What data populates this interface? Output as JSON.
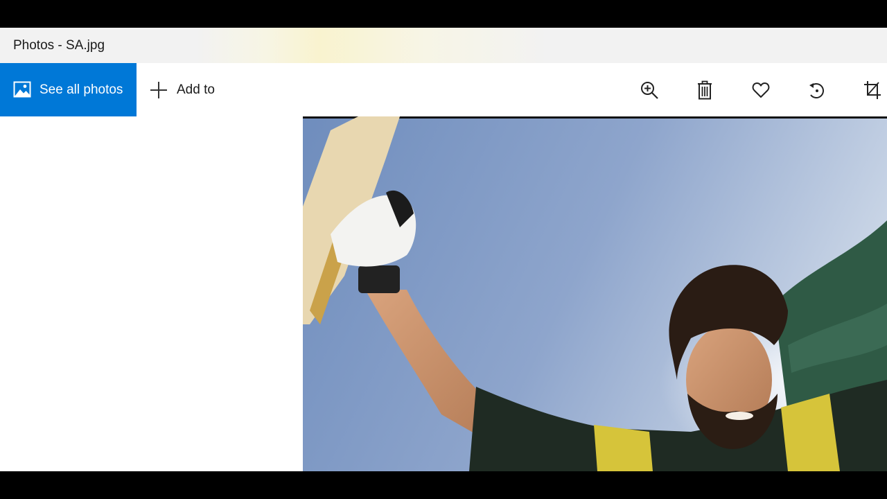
{
  "window": {
    "title": "Photos - SA.jpg"
  },
  "toolbar": {
    "see_all_photos": {
      "label": "See all photos",
      "icon": "image-icon"
    },
    "add_to": {
      "label": "Add to",
      "icon": "plus-icon"
    },
    "actions": [
      {
        "name": "zoom",
        "icon": "zoom-in-icon"
      },
      {
        "name": "delete",
        "icon": "trash-icon"
      },
      {
        "name": "favorite",
        "icon": "heart-icon"
      },
      {
        "name": "rotate",
        "icon": "rotate-icon"
      },
      {
        "name": "crop",
        "icon": "crop-icon"
      }
    ]
  },
  "photo": {
    "file": "SA.jpg"
  },
  "colors": {
    "accent": "#0078d7",
    "titlebar": "#f2f2f2",
    "sky": "#7d97c2",
    "jersey_green": "#1e2a22",
    "jersey_yellow": "#d8c63a"
  }
}
